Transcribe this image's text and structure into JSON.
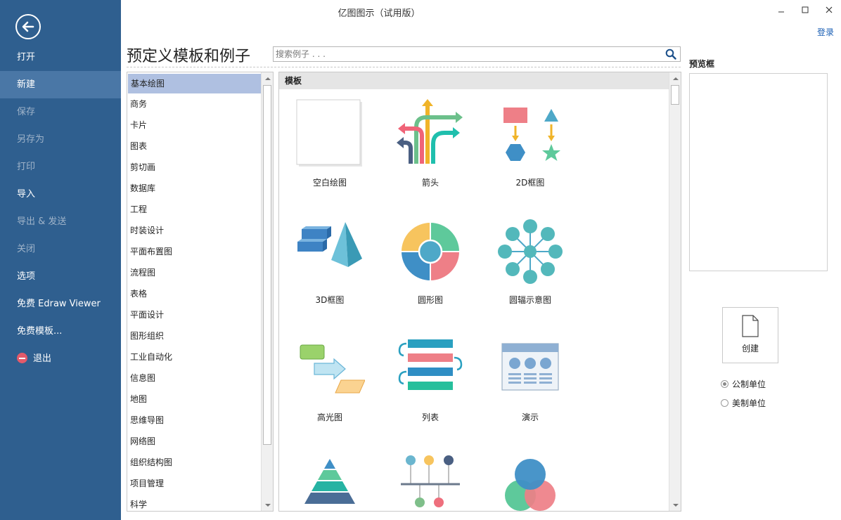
{
  "window": {
    "title": "亿图图示（试用版）",
    "login": "登录"
  },
  "sidebar": {
    "items": [
      {
        "label": "打开",
        "state": "normal"
      },
      {
        "label": "新建",
        "state": "active"
      },
      {
        "label": "保存",
        "state": "disabled"
      },
      {
        "label": "另存为",
        "state": "disabled"
      },
      {
        "label": "打印",
        "state": "disabled"
      },
      {
        "label": "导入",
        "state": "normal"
      },
      {
        "label": "导出 & 发送",
        "state": "disabled"
      },
      {
        "label": "关闭",
        "state": "disabled"
      },
      {
        "label": "选项",
        "state": "normal"
      },
      {
        "label": "免费 Edraw Viewer",
        "state": "normal"
      },
      {
        "label": "免费模板...",
        "state": "normal"
      },
      {
        "label": "退出",
        "state": "normal"
      }
    ]
  },
  "main": {
    "heading": "预定义模板和例子",
    "search_placeholder": "搜索例子 . . .",
    "categories": [
      "基本绘图",
      "商务",
      "卡片",
      "图表",
      "剪切画",
      "数据库",
      "工程",
      "时装设计",
      "平面布置图",
      "流程图",
      "表格",
      "平面设计",
      "图形组织",
      "工业自动化",
      "信息图",
      "地图",
      "思维导图",
      "网络图",
      "组织结构图",
      "项目管理",
      "科学"
    ],
    "selected_category": "基本绘图",
    "templates_header": "模板",
    "templates": [
      "空白绘图",
      "箭头",
      "2D框图",
      "3D框图",
      "圆形图",
      "圆辐示意图",
      "高光图",
      "列表",
      "演示",
      "",
      "",
      ""
    ]
  },
  "preview": {
    "label": "预览框",
    "create": "创建",
    "units": [
      {
        "label": "公制单位",
        "checked": true
      },
      {
        "label": "美制单位",
        "checked": false
      }
    ]
  },
  "colors": {
    "sidebar": "#2f5f8f",
    "sidebar_active": "#4a77a6",
    "selection": "#afc0e1",
    "link": "#1a5fb4"
  }
}
